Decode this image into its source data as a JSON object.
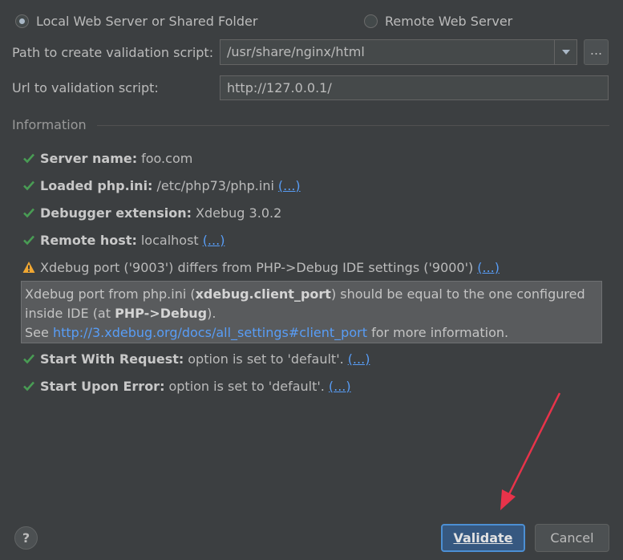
{
  "server_type": {
    "local_label": "Local Web Server or Shared Folder",
    "remote_label": "Remote Web Server",
    "selected": "local"
  },
  "path_field": {
    "label": "Path to create validation script:",
    "value": "/usr/share/nginx/html",
    "browse_label": "..."
  },
  "url_field": {
    "label": "Url to validation script:",
    "value": "http://127.0.0.1/"
  },
  "information": {
    "title": "Information",
    "items": [
      {
        "status": "ok",
        "label": "Server name:",
        "value": "foo.com",
        "link": ""
      },
      {
        "status": "ok",
        "label": "Loaded php.ini:",
        "value": "/etc/php73/php.ini",
        "link": "(...)"
      },
      {
        "status": "ok",
        "label": "Debugger extension:",
        "value": "Xdebug 3.0.2",
        "link": ""
      },
      {
        "status": "ok",
        "label": "Remote host:",
        "value": "localhost",
        "link": "(...)"
      }
    ],
    "warning": {
      "text": "Xdebug port ('9003') differs from PHP->Debug IDE settings ('9000')",
      "link": "(...)",
      "detail": {
        "part1": "Xdebug port from php.ini (",
        "bold1": "xdebug.client_port",
        "part2": ") should be equal to the one configured inside IDE (at ",
        "bold2": "PHP->Debug",
        "part3": ").",
        "see": "See",
        "url": "http://3.xdebug.org/docs/all_settings#client_port",
        "suffix": "for more information."
      }
    },
    "items_after": [
      {
        "status": "ok",
        "label": "Start With Request:",
        "value": "option is set to 'default'.",
        "link": "(...)"
      },
      {
        "status": "ok",
        "label": "Start Upon Error:",
        "value": "option is set to 'default'.",
        "link": "(...)"
      }
    ]
  },
  "footer": {
    "help_label": "?",
    "validate_label": "Validate",
    "cancel_label": "Cancel"
  },
  "colors": {
    "background": "#3c3f41",
    "ok": "#499c54",
    "warning": "#f0a732",
    "link": "#589df6",
    "annotation_arrow": "#e8334a"
  }
}
